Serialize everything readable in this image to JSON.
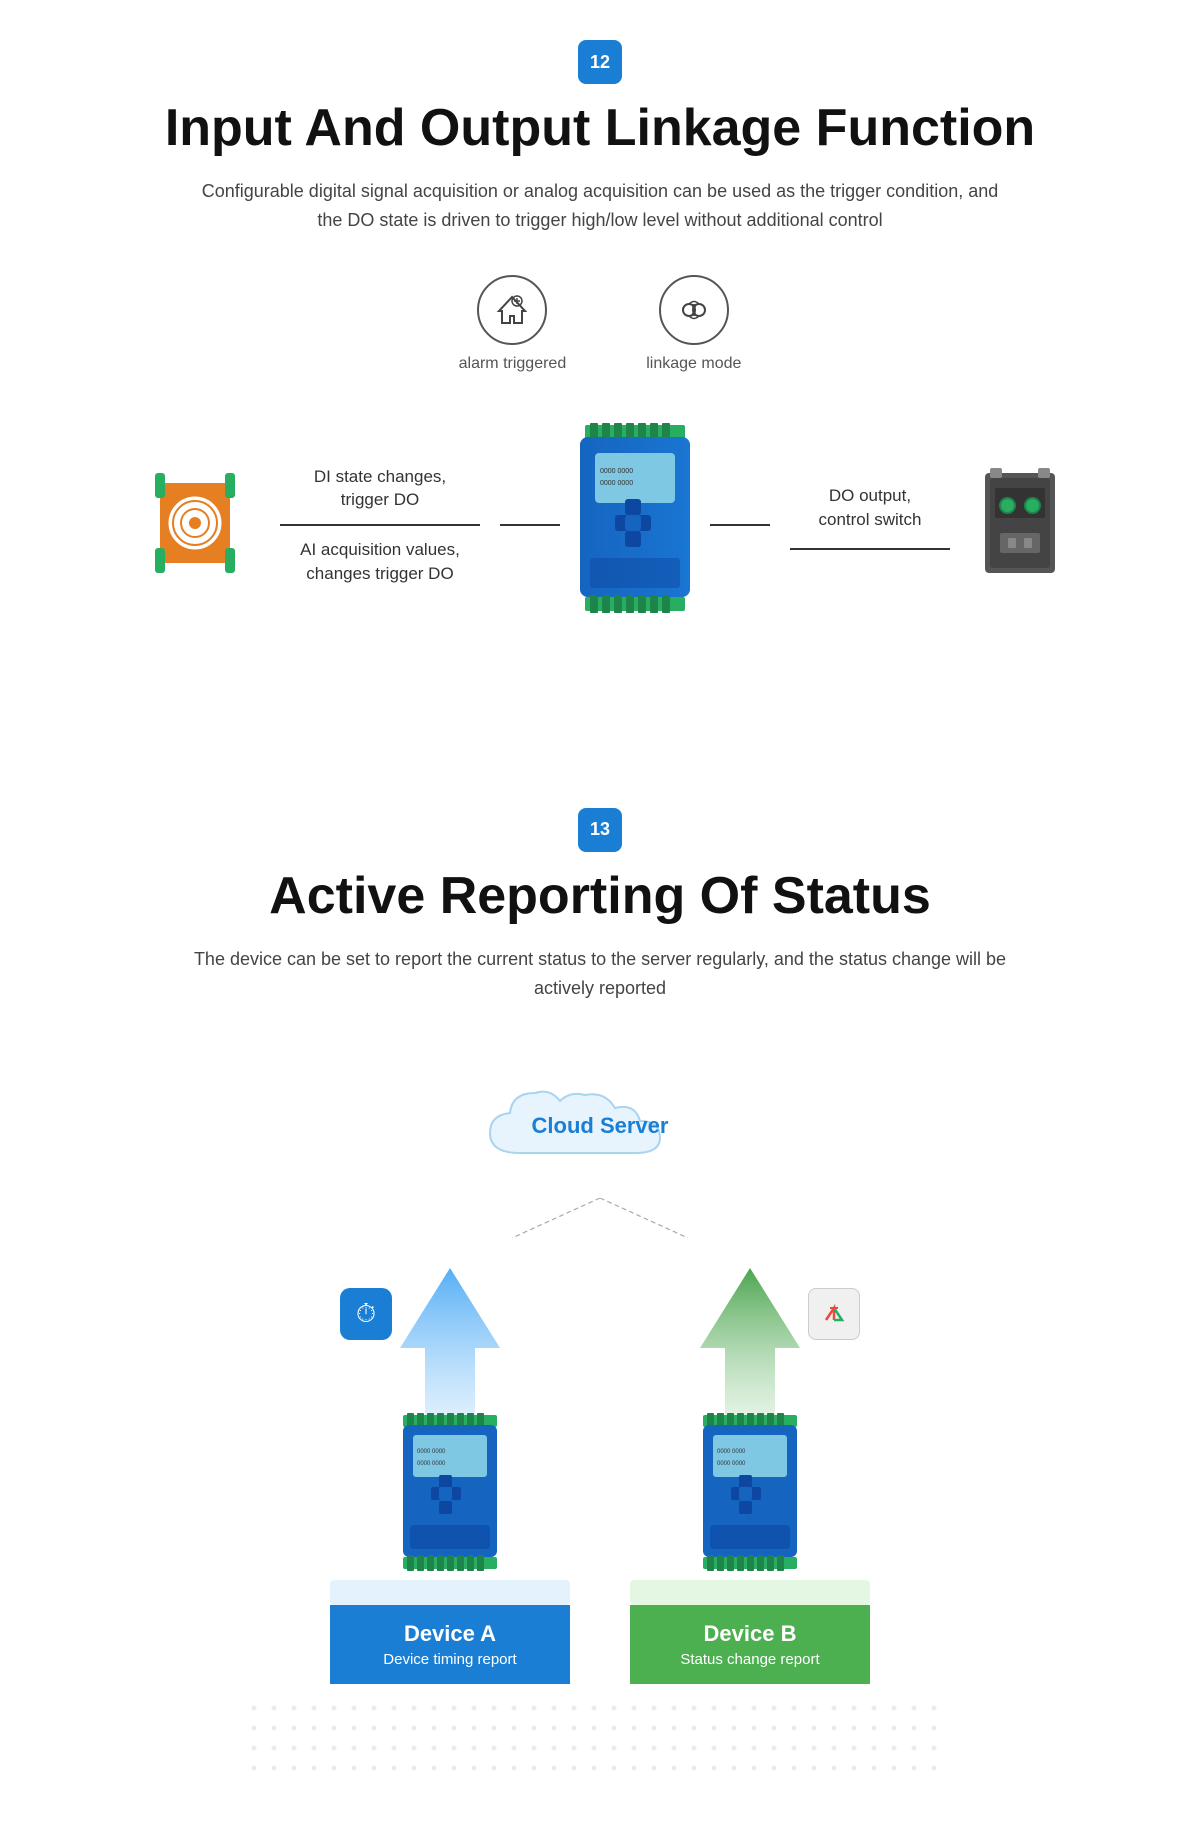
{
  "section1": {
    "badge": "12",
    "title": "Input And Output Linkage Function",
    "description": "Configurable digital signal acquisition or analog  acquisition can be used as the trigger condition, and the DO state is driven to trigger high/low level without additional control",
    "icon1_label": "alarm triggered",
    "icon2_label": "linkage mode",
    "di_text_top": "DI state changes,",
    "di_text_top2": "trigger DO",
    "di_text_bot": "AI acquisition values,",
    "di_text_bot2": "changes trigger DO",
    "do_text_top": "DO output,",
    "do_text_top2": "control switch"
  },
  "section2": {
    "badge": "13",
    "title": "Active Reporting Of Status",
    "description": "The device can be set to report the current status to the server regularly, and the status change will be actively reported",
    "cloud_label": "Cloud Server",
    "device_a_label": "Device A",
    "device_a_sub": "Device timing report",
    "device_b_label": "Device B",
    "device_b_sub": "Status change report"
  }
}
